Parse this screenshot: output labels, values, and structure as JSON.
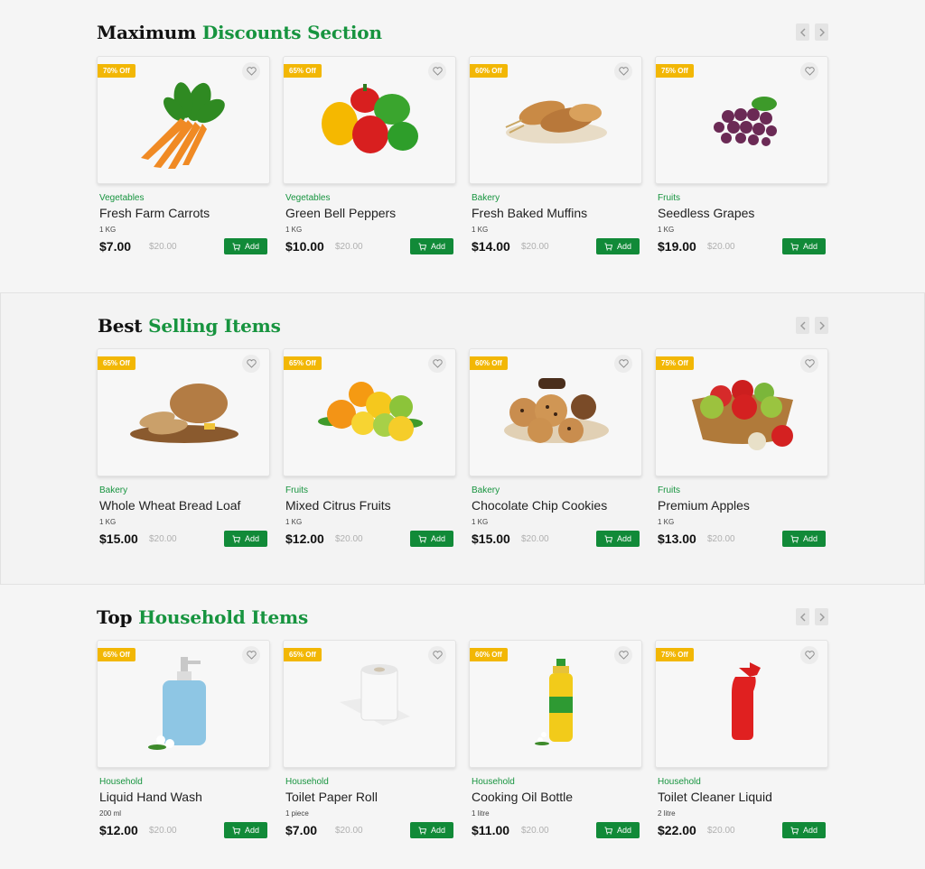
{
  "sections": [
    {
      "title_main": "Maximum",
      "title_accent": "Discounts Section",
      "products": [
        {
          "discount": "70% Off",
          "category": "Vegetables",
          "name": "Fresh Farm Carrots",
          "unit": "1 KG",
          "price": "$7.00",
          "old_price": "$20.00",
          "add_label": "Add",
          "image": "carrots"
        },
        {
          "discount": "65% Off",
          "category": "Vegetables",
          "name": "Green Bell Peppers",
          "unit": "1 KG",
          "price": "$10.00",
          "old_price": "$20.00",
          "add_label": "Add",
          "image": "bell-peppers"
        },
        {
          "discount": "60% Off",
          "category": "Bakery",
          "name": "Fresh Baked Muffins",
          "unit": "1 KG",
          "price": "$14.00",
          "old_price": "$20.00",
          "add_label": "Add",
          "image": "baked-bread"
        },
        {
          "discount": "75% Off",
          "category": "Fruits",
          "name": "Seedless Grapes",
          "unit": "1 KG",
          "price": "$19.00",
          "old_price": "$20.00",
          "add_label": "Add",
          "image": "grapes"
        }
      ]
    },
    {
      "title_main": "Best",
      "title_accent": "Selling Items",
      "products": [
        {
          "discount": "65% Off",
          "category": "Bakery",
          "name": "Whole Wheat Bread Loaf",
          "unit": "1 KG",
          "price": "$15.00",
          "old_price": "$20.00",
          "add_label": "Add",
          "image": "bread-loaf"
        },
        {
          "discount": "65% Off",
          "category": "Fruits",
          "name": "Mixed Citrus Fruits",
          "unit": "1 KG",
          "price": "$12.00",
          "old_price": "$20.00",
          "add_label": "Add",
          "image": "citrus"
        },
        {
          "discount": "60% Off",
          "category": "Bakery",
          "name": "Chocolate Chip Cookies",
          "unit": "1 KG",
          "price": "$15.00",
          "old_price": "$20.00",
          "add_label": "Add",
          "image": "cookies"
        },
        {
          "discount": "75% Off",
          "category": "Fruits",
          "name": "Premium Apples",
          "unit": "1 KG",
          "price": "$13.00",
          "old_price": "$20.00",
          "add_label": "Add",
          "image": "apples"
        }
      ]
    },
    {
      "title_main": "Top",
      "title_accent": "Household Items",
      "products": [
        {
          "discount": "65% Off",
          "category": "Household",
          "name": "Liquid Hand Wash",
          "unit": "200 ml",
          "price": "$12.00",
          "old_price": "$20.00",
          "add_label": "Add",
          "image": "hand-wash"
        },
        {
          "discount": "65% Off",
          "category": "Household",
          "name": "Toilet Paper Roll",
          "unit": "1 piece",
          "price": "$7.00",
          "old_price": "$20.00",
          "add_label": "Add",
          "image": "toilet-paper"
        },
        {
          "discount": "60% Off",
          "category": "Household",
          "name": "Cooking Oil Bottle",
          "unit": "1 litre",
          "price": "$11.00",
          "old_price": "$20.00",
          "add_label": "Add",
          "image": "oil-bottle"
        },
        {
          "discount": "75% Off",
          "category": "Household",
          "name": "Toilet Cleaner Liquid",
          "unit": "2 litre",
          "price": "$22.00",
          "old_price": "$20.00",
          "add_label": "Add",
          "image": "toilet-cleaner"
        }
      ]
    }
  ],
  "colors": {
    "accent": "#17943f",
    "badge": "#f2b705",
    "add_button": "#118a38"
  }
}
